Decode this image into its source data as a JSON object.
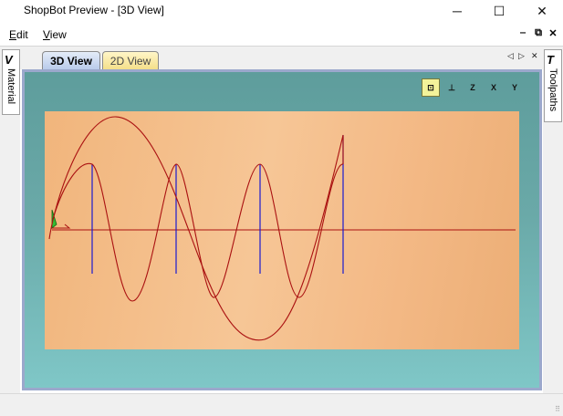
{
  "window": {
    "title": "ShopBot Preview - [3D View]",
    "minimize_glyph": "─",
    "maximize_glyph": "☐",
    "close_glyph": "✕"
  },
  "menu": {
    "edit": "Edit",
    "edit_key": "E",
    "edit_rest": "dit",
    "view_key": "V",
    "view_rest": "iew"
  },
  "mdi": {
    "min": "‒",
    "restore": "⧉",
    "close": "✕"
  },
  "tabs": {
    "tab_3d": "3D View",
    "tab_2d": "2D View",
    "prev": "◁",
    "next": "▷",
    "close": "✕"
  },
  "side_panels": {
    "material": "Material",
    "toolpaths": "Toolpaths"
  },
  "view_icons": [
    {
      "name": "zoom-extents-icon",
      "glyph": "⊡"
    },
    {
      "name": "iso-view-icon",
      "glyph": "⊥"
    },
    {
      "name": "view-z-icon",
      "glyph": "Z"
    },
    {
      "name": "view-x-icon",
      "glyph": "X"
    },
    {
      "name": "view-y-icon",
      "glyph": "Y"
    }
  ],
  "colors": {
    "viewport_top": "#5e9d9c",
    "viewport_bottom": "#7fc7c7",
    "material": "#f4bf8c",
    "cut_path": "#aa1111",
    "plunge": "#1a1ad0",
    "origin_x": "#aa1111",
    "origin_y": "#22aa22"
  }
}
